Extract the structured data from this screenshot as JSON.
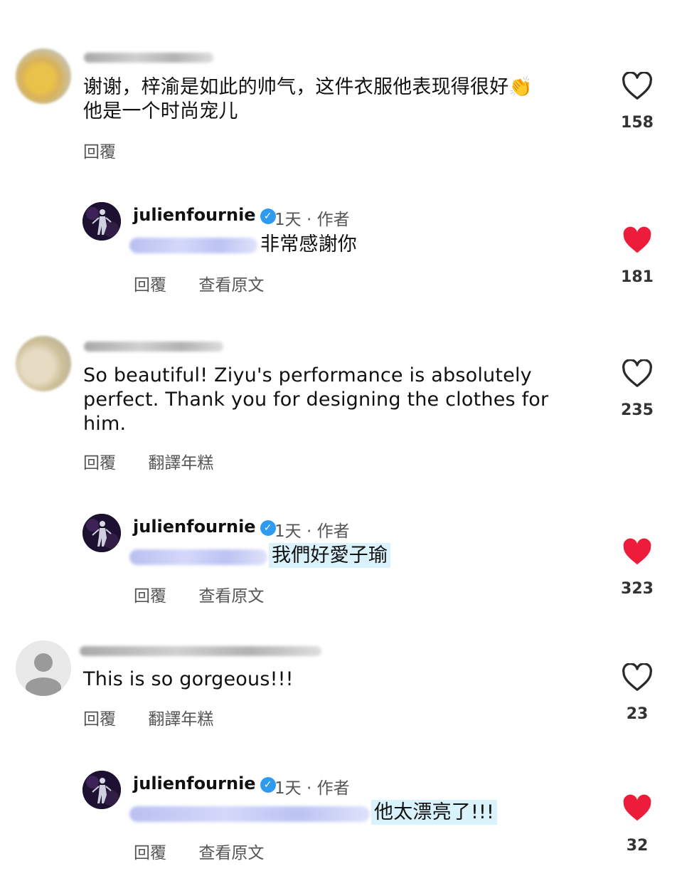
{
  "comments": [
    {
      "text_lines": [
        "谢谢，梓渝是如此的帅气，这件衣服他表现得很好👏",
        "他是一个时尚宠儿"
      ],
      "actions": [
        "回覆"
      ],
      "likes": "158",
      "liked": false,
      "reply": {
        "username": "julienfournie",
        "time": "1天",
        "author_tag": "作者",
        "text": "非常感謝你",
        "actions": [
          "回覆",
          "查看原文"
        ],
        "likes": "181",
        "liked": true
      }
    },
    {
      "text_lines": [
        "So beautiful! Ziyu's performance is absolutely",
        "perfect. Thank you for designing the clothes for",
        "him."
      ],
      "actions": [
        "回覆",
        "翻譯年糕"
      ],
      "likes": "235",
      "liked": false,
      "reply": {
        "username": "julienfournie",
        "time": "1天",
        "author_tag": "作者",
        "text": "我們好愛子瑜",
        "actions": [
          "回覆",
          "查看原文"
        ],
        "likes": "323",
        "liked": true
      }
    },
    {
      "text_lines": [
        "This is so gorgeous!!!"
      ],
      "actions": [
        "回覆",
        "翻譯年糕"
      ],
      "likes": "23",
      "liked": false,
      "reply": {
        "username": "julienfournie",
        "time": "1天",
        "author_tag": "作者",
        "text": "他太漂亮了!!!",
        "actions": [
          "回覆",
          "查看原文"
        ],
        "likes": "32",
        "liked": true
      }
    }
  ],
  "colors": {
    "heart_liked": "#ed1c3a",
    "heart_outline": "#2a2a2a",
    "verified": "#2f9bf0",
    "highlight": "#d9f2fb"
  }
}
